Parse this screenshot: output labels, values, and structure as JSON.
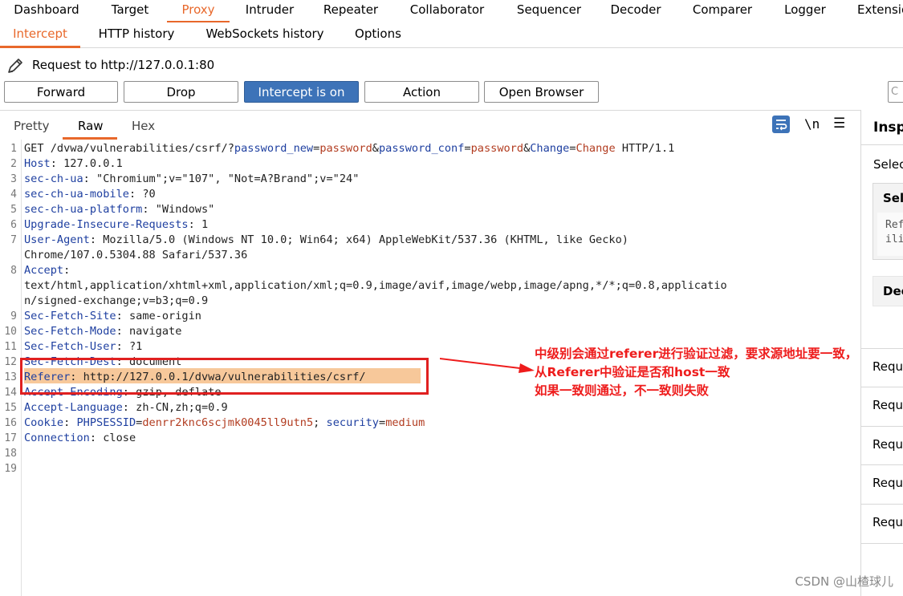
{
  "main_tabs": [
    "Dashboard",
    "Target",
    "Proxy",
    "Intruder",
    "Repeater",
    "Collaborator",
    "Sequencer",
    "Decoder",
    "Comparer",
    "Logger",
    "Extensio"
  ],
  "sub_tabs": [
    "Intercept",
    "HTTP history",
    "WebSockets history",
    "Options"
  ],
  "request_line": "Request to http://127.0.0.1:80",
  "buttons": {
    "forward": "Forward",
    "drop": "Drop",
    "intercept": "Intercept is on",
    "action": "Action",
    "open_browser": "Open Browser",
    "search_fragment": "C"
  },
  "view_tabs": [
    "Pretty",
    "Raw",
    "Hex"
  ],
  "newline_label": "\\n",
  "request": {
    "line1": {
      "method": "GET",
      "path": "/dvwa/vulnerabilities/csrf/?",
      "p1n": "password_new",
      "p1v": "password",
      "p2n": "password_conf",
      "p2v": "password",
      "p3n": "Change",
      "p3v": "Change",
      "proto": " HTTP/1.1"
    },
    "line_numbers": [
      "1",
      "2",
      "3",
      "4",
      "5",
      "6",
      "7",
      "",
      "8",
      "",
      "",
      "9",
      "10",
      "11",
      "12",
      "13",
      "14",
      "15",
      "16",
      "17",
      "18",
      "19"
    ],
    "headers": {
      "host": {
        "k": "Host",
        "v": " 127.0.0.1"
      },
      "sec_ch_ua": {
        "k": "sec-ch-ua",
        "v": " \"Chromium\";v=\"107\", \"Not=A?Brand\";v=\"24\""
      },
      "mobile": {
        "k": "sec-ch-ua-mobile",
        "v": " ?0"
      },
      "platform": {
        "k": "sec-ch-ua-platform",
        "v": " \"Windows\""
      },
      "upgrade": {
        "k": "Upgrade-Insecure-Requests",
        "v": " 1"
      },
      "ua": {
        "k": "User-Agent",
        "v": " Mozilla/5.0 (Windows NT 10.0; Win64; x64) AppleWebKit/537.36 (KHTML, like Gecko)",
        "cont": "Chrome/107.0.5304.88 Safari/537.36"
      },
      "accept": {
        "k": "Accept",
        "v": "",
        "cont1": "text/html,application/xhtml+xml,application/xml;q=0.9,image/avif,image/webp,image/apng,*/*;q=0.8,applicatio",
        "cont2": "n/signed-exchange;v=b3;q=0.9"
      },
      "site": {
        "k": "Sec-Fetch-Site",
        "v": " same-origin"
      },
      "mode": {
        "k": "Sec-Fetch-Mode",
        "v": " navigate"
      },
      "user": {
        "k": "Sec-Fetch-User",
        "v": " ?1"
      },
      "dest": {
        "k": "Sec-Fetch-Dest",
        "v": " document"
      },
      "referer": {
        "k": "Referer",
        "v": " http://127.0.0.1/dvwa/vulnerabilities/csrf/"
      },
      "encoding": {
        "k": "Accept-Encoding",
        "v": " gzip, deflate"
      },
      "language": {
        "k": "Accept-Language",
        "v": " zh-CN,zh;q=0.9"
      },
      "cookie": {
        "k": "Cookie",
        "c1n": "PHPSESSID",
        "c1v": "denrr2knc6scjmk0045ll9utn5",
        "c2n": "security",
        "c2v": "medium"
      },
      "connection": {
        "k": "Connection",
        "v": " close"
      }
    }
  },
  "annotation": [
    "中级别会通过referer进行验证过滤，要求源地址要一致，",
    "从Referer中验证是否和host一致",
    "如果一致则通过，不一致则失败"
  ],
  "inspector": {
    "title": "Insp",
    "select": "Selec",
    "box_head": "Sele",
    "box_text1": "Ref",
    "box_text2": "ili",
    "decoded": "Dec",
    "rows": [
      "Requ",
      "Requ",
      "Requ",
      "Requ",
      "Requ"
    ]
  },
  "watermark": "CSDN @山楂球儿",
  "colors": {
    "accent": "#e8682b",
    "button_on": "#3d73b8",
    "annotation": "#ee1c1c",
    "highlight": "#f7c89a"
  }
}
